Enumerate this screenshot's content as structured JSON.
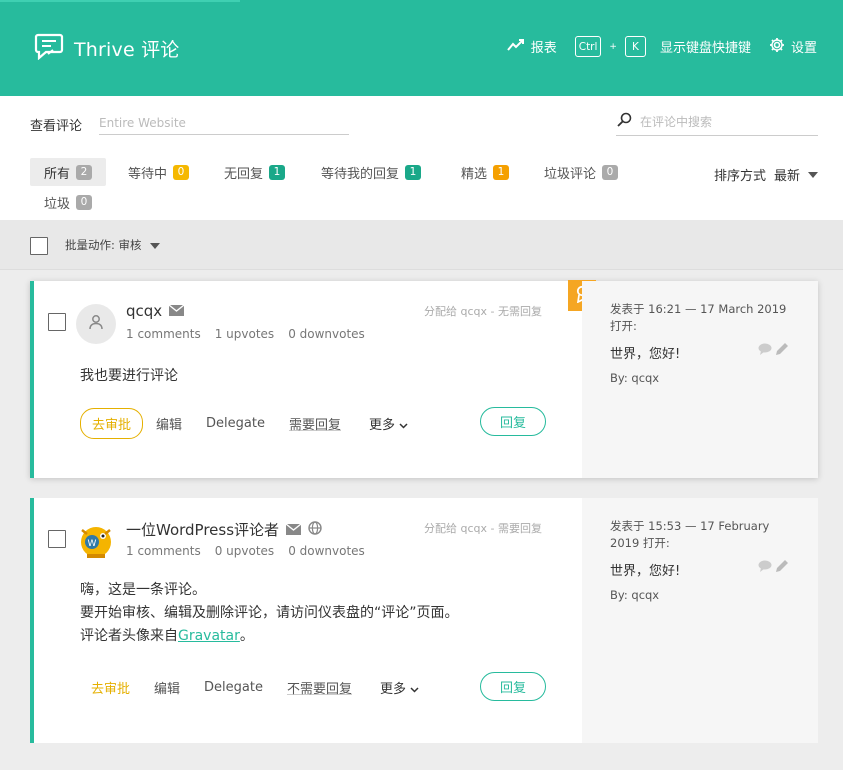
{
  "header": {
    "title": "Thrive 评论",
    "reports_label": "报表",
    "kbd_ctrl": "Ctrl",
    "kbd_plus": "+",
    "kbd_k": "K",
    "shortcuts_label": "显示键盘快捷键",
    "settings_label": "设置"
  },
  "toolbar": {
    "view_label": "查看评论",
    "view_placeholder": "Entire Website",
    "search_placeholder": "在评论中搜索"
  },
  "filters": [
    {
      "label": "所有",
      "count": "2"
    },
    {
      "label": "等待中",
      "count": "0"
    },
    {
      "label": "无回复",
      "count": "1"
    },
    {
      "label": "等待我的回复",
      "count": "1"
    },
    {
      "label": "精选",
      "count": "1"
    },
    {
      "label": "垃圾评论",
      "count": "0"
    },
    {
      "label": "垃圾",
      "count": "0"
    }
  ],
  "sort": {
    "label": "排序方式",
    "value": "最新"
  },
  "bulk": {
    "label": "批量动作: 审核"
  },
  "comments": [
    {
      "author": "qcqx",
      "comments_count": "1 comments",
      "upvotes": "1 upvotes",
      "downvotes": "0 downvotes",
      "assigned": "分配给 qcqx - 无需回复",
      "body": "我也要进行评论",
      "actions": {
        "unapprove": "去审批",
        "edit": "编辑",
        "delegate": "Delegate",
        "reply_needed": "需要回复",
        "more": "更多"
      },
      "reply": "回复",
      "posted": "发表于 16:21 — 17 March 2019",
      "posted_line2": "打开:",
      "post_title": "世界，您好!",
      "by": "By: qcqx"
    },
    {
      "author": "一位WordPress评论者",
      "comments_count": "1 comments",
      "upvotes": "0 upvotes",
      "downvotes": "0 downvotes",
      "assigned": "分配给 qcqx - 需要回复",
      "body_line1": "嗨，这是一条评论。",
      "body_line2": "要开始审核、编辑及删除评论，请访问仪表盘的“评论”页面。",
      "body_line3_prefix": "评论者头像来自",
      "body_link": "Gravatar",
      "body_line3_suffix": "。",
      "actions": {
        "unapprove": "去审批",
        "edit": "编辑",
        "delegate": "Delegate",
        "reply_needed": "不需要回复",
        "more": "更多"
      },
      "reply": "回复",
      "posted": "发表于 15:53 — 17 February",
      "posted_line2": "2019 打开:",
      "post_title": "世界，您好!",
      "by": "By: qcqx"
    }
  ],
  "colors": {
    "brand": "#27bb9d",
    "badge_yellow": "#f5b800",
    "badge_green": "#1aa889",
    "featured": "#f5a623"
  }
}
